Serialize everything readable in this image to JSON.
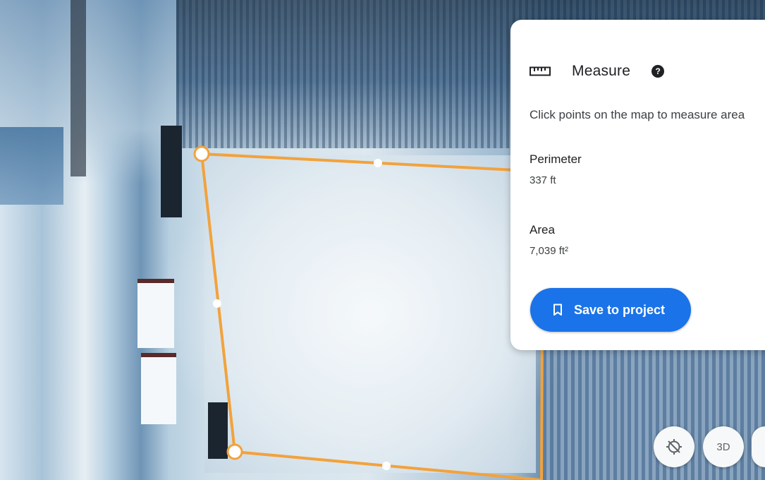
{
  "panel": {
    "icon": "ruler-icon",
    "title": "Measure",
    "help_icon": "help-icon",
    "help_symbol": "?",
    "description": "Click points on the map to measure area",
    "perimeter": {
      "label": "Perimeter",
      "value": "337 ft"
    },
    "area": {
      "label": "Area",
      "value": "7,039 ft²"
    },
    "save_button": {
      "icon": "bookmark-icon",
      "label": "Save to project"
    }
  },
  "map_controls": {
    "compass_icon": "compass-off-icon",
    "view_3d_label": "3D"
  },
  "colors": {
    "accent": "#1a73e8",
    "measure_line": "#f2a23c",
    "panel_bg": "#ffffff"
  }
}
